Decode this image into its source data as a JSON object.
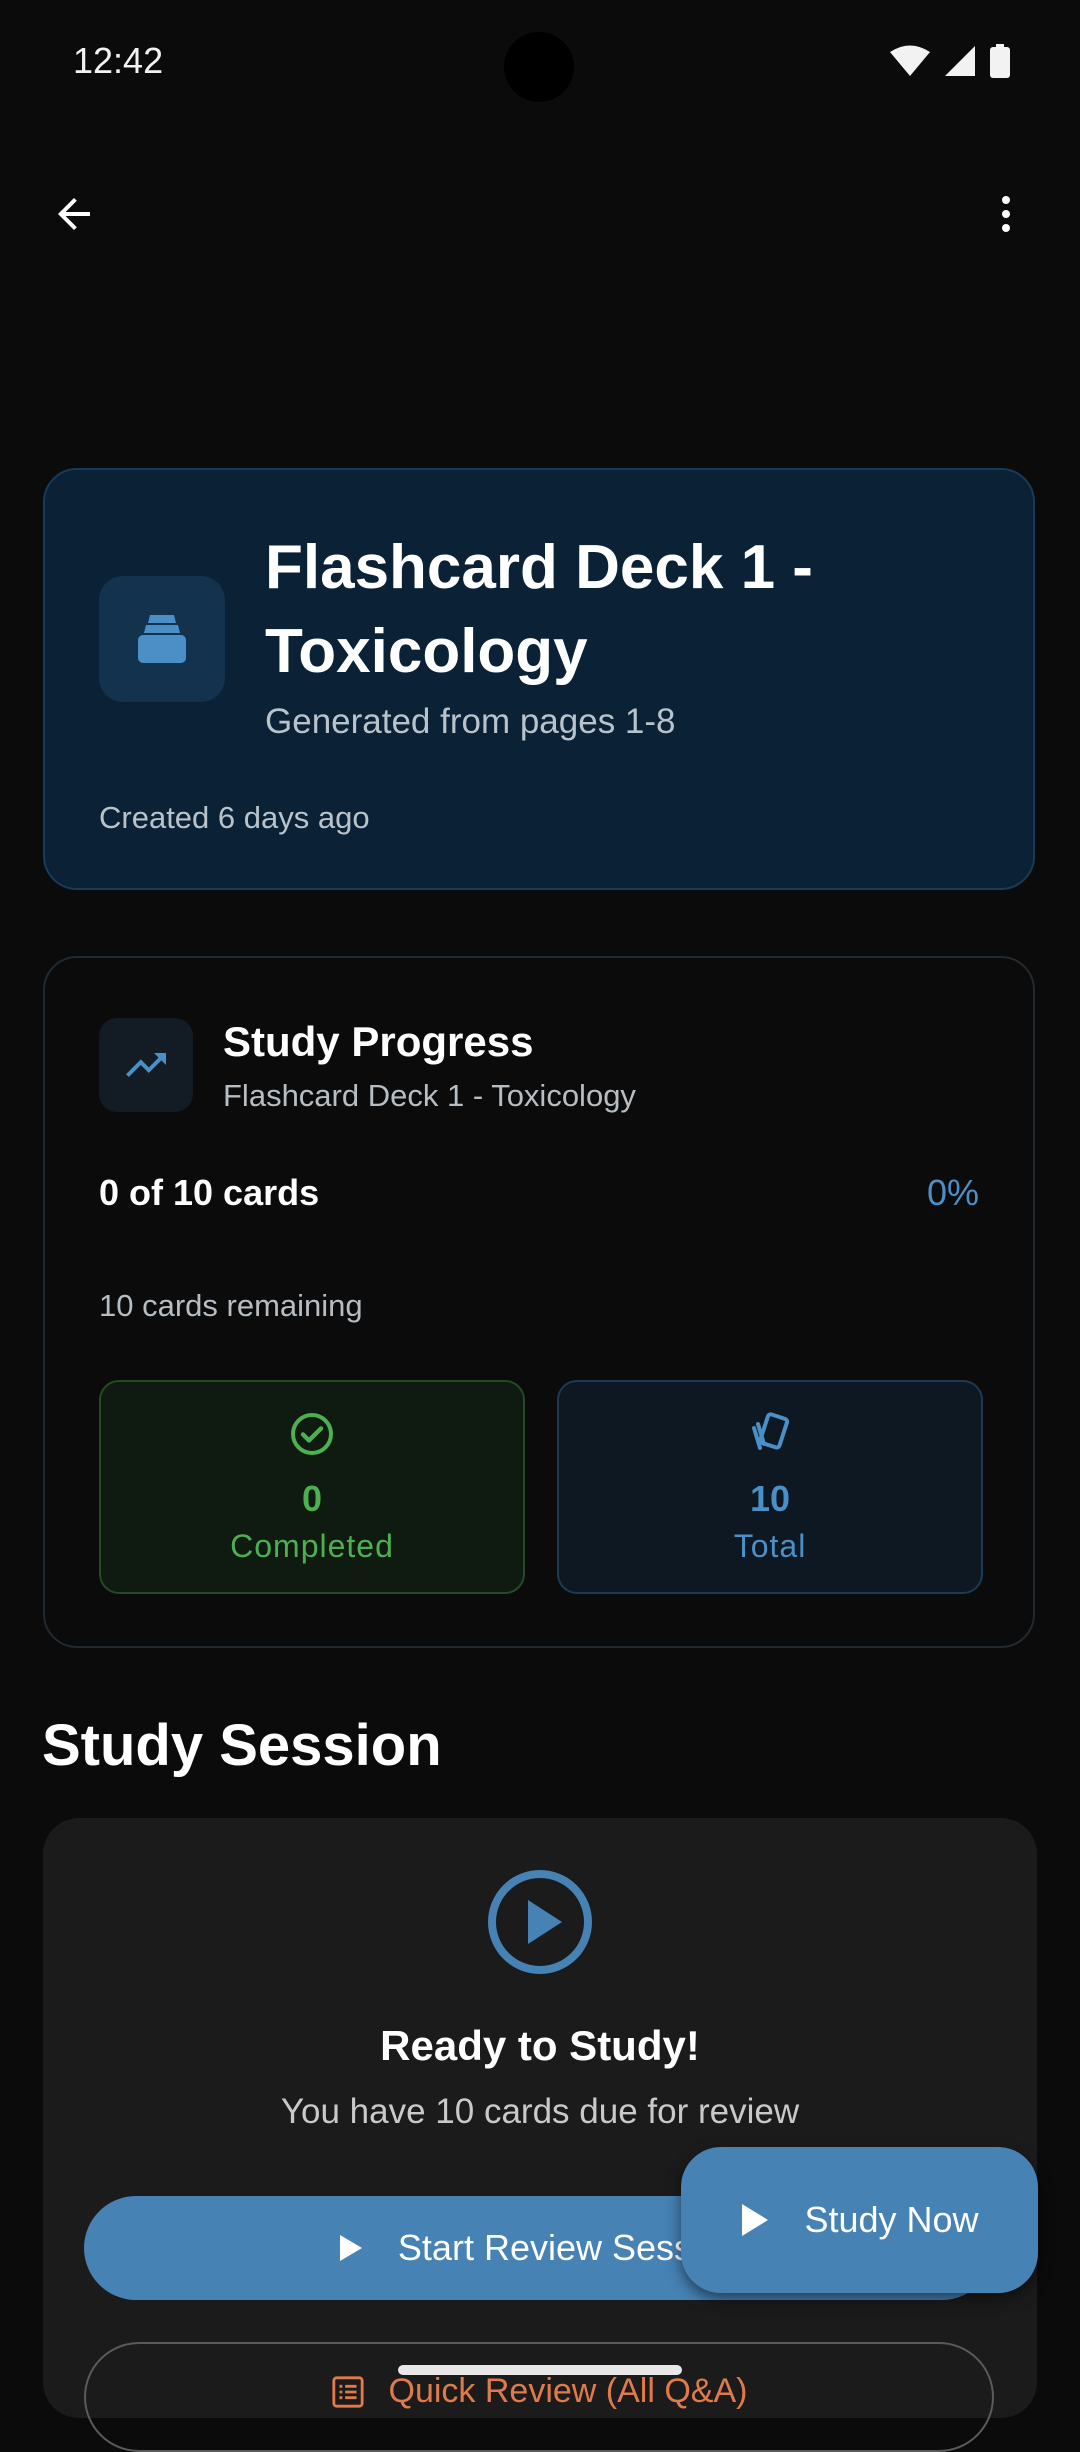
{
  "status_bar": {
    "time": "12:42"
  },
  "deck": {
    "title": "Flashcard Deck 1 - Toxicology",
    "subtitle": "Generated from pages 1-8",
    "created": "Created 6 days ago"
  },
  "progress": {
    "title": "Study Progress",
    "subtitle": "Flashcard Deck 1 - Toxicology",
    "count_text": "0 of 10 cards",
    "percent_text": "0%",
    "percent_value": 0,
    "remaining_text": "10 cards remaining",
    "completed_value": "0",
    "completed_label": "Completed",
    "total_value": "10",
    "total_label": "Total"
  },
  "session": {
    "heading": "Study Session",
    "ready_title": "Ready to Study!",
    "ready_subtitle": "You have 10 cards due for review",
    "start_button": "Start Review Session",
    "quick_button": "Quick Review (All Q&A)"
  },
  "fab": {
    "label": "Study Now"
  },
  "colors": {
    "accent": "#4682b4",
    "success": "#4caf50",
    "deck_card_bg": "#0b2135",
    "quick_accent": "#e07a4a"
  },
  "icons": {
    "back": "arrow-back-icon",
    "more": "more-vert-icon",
    "deck": "deck-stack-icon",
    "progress": "trending-up-icon",
    "completed": "check-circle-icon",
    "total": "cards-icon",
    "play": "play-circle-icon"
  }
}
